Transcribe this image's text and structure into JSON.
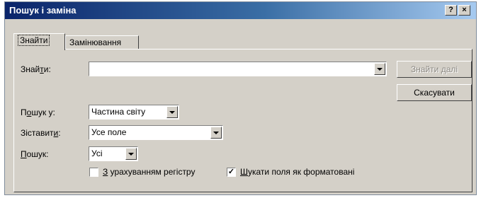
{
  "window": {
    "title": "Пошук і заміна",
    "help_glyph": "?",
    "close_glyph": "×"
  },
  "tabs": [
    {
      "label": "Знайти",
      "active": true
    },
    {
      "label": "Замінювання",
      "active": false
    }
  ],
  "find": {
    "label_before": "Знай",
    "label_underline": "т",
    "label_after": "и:",
    "value": ""
  },
  "buttons": {
    "find_next": "Знайти далі",
    "cancel": "Скасувати"
  },
  "search_in": {
    "label_before": "П",
    "label_underline": "о",
    "label_after": "шук у:",
    "value": "Частина світу"
  },
  "match": {
    "label_before": "Зіставит",
    "label_underline": "и",
    "label_after": ":",
    "value": "Усе поле"
  },
  "search": {
    "label_before": "",
    "label_underline": "П",
    "label_after": "ошук:",
    "value": "Усі"
  },
  "options": {
    "match_case": {
      "label_underline": "З",
      "label_after": " урахуванням регістру",
      "checked": false
    },
    "search_formatted": {
      "label_underline": "Ш",
      "label_after": "укати поля як форматовані",
      "checked": true,
      "check_glyph": "✓"
    }
  }
}
